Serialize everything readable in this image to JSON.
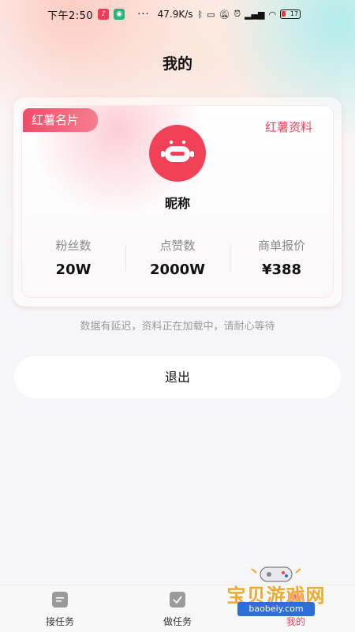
{
  "status_bar": {
    "time": "下午2:50",
    "more": "···",
    "speed": "47.9K/s",
    "battery": "17"
  },
  "header": {
    "title": "我的"
  },
  "card": {
    "badge": "红薯名片",
    "profile_link": "红薯资料",
    "nickname": "昵称",
    "stats": [
      {
        "label": "粉丝数",
        "value": "20W"
      },
      {
        "label": "点赞数",
        "value": "2000W"
      },
      {
        "label": "商单报价",
        "value": "¥388"
      }
    ]
  },
  "notice": "数据有延迟，资料正在加载中，请耐心等待",
  "logout_label": "退出",
  "tabbar": {
    "tabs": [
      {
        "label": "接任务",
        "icon": "task-list-icon"
      },
      {
        "label": "做任务",
        "icon": "task-check-icon"
      },
      {
        "label": "我的",
        "icon": "profile-icon",
        "active": true
      }
    ]
  },
  "watermark": {
    "title": "宝贝游戏网",
    "url": "baobeiy.com"
  },
  "colors": {
    "accent": "#e8455d",
    "badge": "#f24a6a",
    "avatar": "#f04157"
  }
}
